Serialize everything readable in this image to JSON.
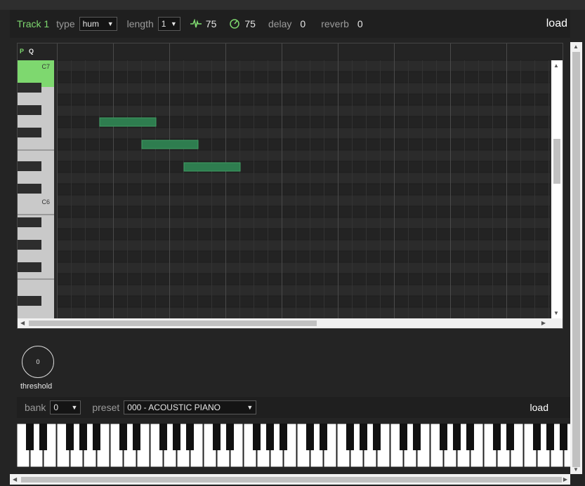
{
  "header": {
    "track_name": "Track 1",
    "type_label": "type",
    "type_value": "hum",
    "length_label": "length",
    "length_value": "1",
    "volume_icon": "waveform-icon",
    "volume_value": "75",
    "tempo_icon": "gauge-icon",
    "tempo_value": "75",
    "delay_label": "delay",
    "delay_value": "0",
    "reverb_label": "reverb",
    "reverb_value": "0",
    "load_label": "load"
  },
  "piano_roll": {
    "p_toggle": "P",
    "q_toggle": "Q",
    "key_labels": [
      "C7",
      "C6"
    ],
    "notes": [
      {
        "row": 5,
        "start": 1,
        "length": 2
      },
      {
        "row": 7,
        "start": 4,
        "length": 2
      },
      {
        "row": 9,
        "start": 7,
        "length": 2
      }
    ]
  },
  "knob": {
    "value": "0",
    "label": "threshold"
  },
  "instrument": {
    "bank_label": "bank",
    "bank_value": "0",
    "preset_label": "preset",
    "preset_value": "000 - ACOUSTIC PIANO",
    "load_label": "load"
  },
  "colors": {
    "accent_green": "#7ed86f",
    "note_green": "#2e7d4f",
    "background": "#242424"
  }
}
